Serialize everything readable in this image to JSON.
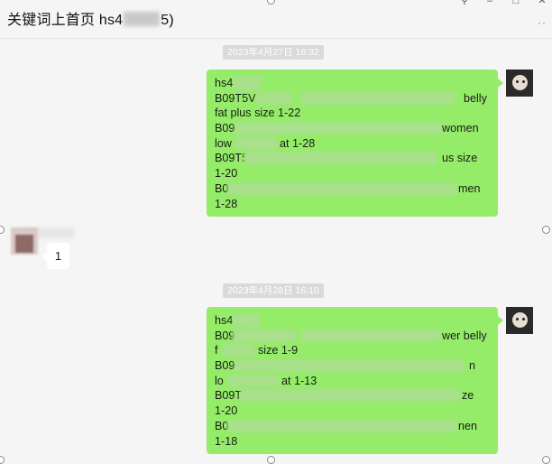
{
  "window": {
    "title_prefix": "关键词上首页  hs4",
    "title_suffix": "5)",
    "btn_pin": "⚲",
    "btn_min": "–",
    "btn_max": "□",
    "btn_close": "✕",
    "more": "··"
  },
  "messages": [
    {
      "timestamp": "2023年4月27日 16:32",
      "lines": [
        "hs4",
        "B09T5V",
        "fat plus size 1-22",
        "B09",
        "low",
        "B09T5",
        "1-20",
        "B0",
        "1-28"
      ],
      "line_tails": [
        "",
        "belly",
        "",
        "women",
        "at 1-28",
        "us size",
        "",
        "men",
        ""
      ]
    },
    {
      "sender_text": "1"
    },
    {
      "timestamp": "2023年4月28日 16:10",
      "lines": [
        "hs4",
        "B09",
        "f",
        "B09",
        "lo",
        "B09T",
        "1-20",
        "B0",
        "1-18"
      ],
      "line_tails": [
        "",
        "wer belly",
        "size 1-9",
        "n",
        "at 1-13",
        "ze",
        "",
        "nen",
        ""
      ]
    }
  ]
}
